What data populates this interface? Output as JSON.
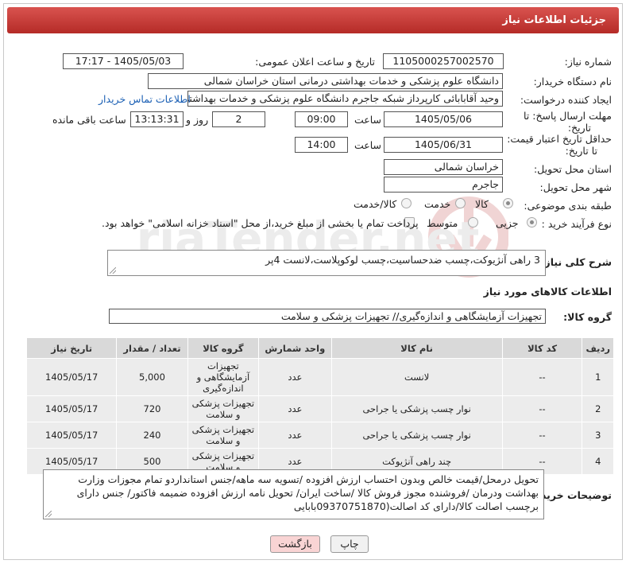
{
  "header": {
    "title": "جزئیات اطلاعات نیاز"
  },
  "fields": {
    "need_number": {
      "label": "شماره نیاز:",
      "value": "1105000257002570"
    },
    "announce_datetime": {
      "label": "تاریخ و ساعت اعلان عمومی:",
      "value": "1405/05/03 - 17:17"
    },
    "buyer_org": {
      "label": "نام دستگاه خریدار:",
      "value": "دانشگاه علوم پزشکی و خدمات بهداشتی درمانی استان خراسان شمالی"
    },
    "requester": {
      "label": "ایجاد کننده درخواست:",
      "value": "وحید آقابابائی کارپرداز شبکه جاجرم دانشگاه علوم پزشکی و خدمات بهداشتی د",
      "contact_link": "اطلاعات تماس خریدار"
    },
    "deadline": {
      "label_line1": "مهلت ارسال پاسخ: تا",
      "label_line2": "تاریخ:",
      "date": "1405/05/06",
      "time_label": "ساعت",
      "time": "09:00",
      "days": "2",
      "days_label": "روز و",
      "remaining": "13:13:31",
      "remaining_label": "ساعت باقی مانده"
    },
    "validity": {
      "label_line1": "حداقل تاریخ اعتبار قیمت:",
      "label_line2": "تا تاریخ:",
      "date": "1405/06/31",
      "time_label": "ساعت",
      "time": "14:00"
    },
    "province": {
      "label": "استان محل تحویل:",
      "value": "خراسان شمالی"
    },
    "city": {
      "label": "شهر محل تحویل:",
      "value": "جاجرم"
    },
    "category": {
      "label": "طبقه بندی موضوعی:",
      "options": [
        "کالا",
        "خدمت",
        "کالا/خدمت"
      ],
      "selected": "کالا"
    },
    "purchase_type": {
      "label": "نوع فرآیند خرید :",
      "options": [
        "جزیی",
        "متوسط"
      ],
      "selected": "جزیی",
      "payment_note": "پرداخت تمام یا بخشی از مبلغ خرید،از محل \"اسناد خزانه اسلامی\" خواهد بود."
    },
    "summary": {
      "label": "شرح کلی نیاز:",
      "value": "3 راهی آنژیوکت،چسب ضدحساسیت،چسب لوکوپلاست،لانست 4پر"
    }
  },
  "goods_section": {
    "title": "اطلاعات کالاهای مورد نیاز",
    "group_label": "گروه کالا:",
    "group_value": "تجهیزات آزمایشگاهی و اندازه‌گیری// تجهیزات پزشکی و سلامت"
  },
  "table": {
    "headers": [
      "ردیف",
      "کد کالا",
      "نام کالا",
      "واحد شمارش",
      "گروه کالا",
      "تعداد / مقدار",
      "تاریخ نیاز"
    ],
    "rows": [
      [
        "1",
        "--",
        "لانست",
        "عدد",
        "تجهیزات آزمایشگاهی و اندازه‌گیری",
        "5,000",
        "1405/05/17"
      ],
      [
        "2",
        "--",
        "نوار چسب پزشکی یا جراحی",
        "عدد",
        "تجهیزات پزشکی و سلامت",
        "720",
        "1405/05/17"
      ],
      [
        "3",
        "--",
        "نوار چسب پزشکی یا جراحی",
        "عدد",
        "تجهیزات پزشکی و سلامت",
        "240",
        "1405/05/17"
      ],
      [
        "4",
        "--",
        "چند راهی آنژیوکت",
        "عدد",
        "تجهیزات پزشکی و سلامت",
        "500",
        "1405/05/17"
      ]
    ]
  },
  "buyer_notes": {
    "label": "توضیحات خریدار:",
    "value": "تحویل درمحل/قیمت خالص وبدون احتساب ارزش افزوده /تسویه سه ماهه/جنس استانداردو تمام مجوزات وزارت بهداشت ودرمان /فروشنده مجوز فروش کالا /ساخت ایران/ تحویل  نامه ارزش افزوده ضمیمه  فاکتور/ جنس دارای برچسب اصالت کالا/دارای کد اصالت(09370751870بابایی"
  },
  "buttons": {
    "print": "چاپ",
    "back": "بازگشت"
  },
  "watermark": {
    "text": "AriaTender.net"
  },
  "colors": {
    "header": "#c9302c",
    "link": "#1a5fb4",
    "back_button": "#f9d4d4"
  }
}
